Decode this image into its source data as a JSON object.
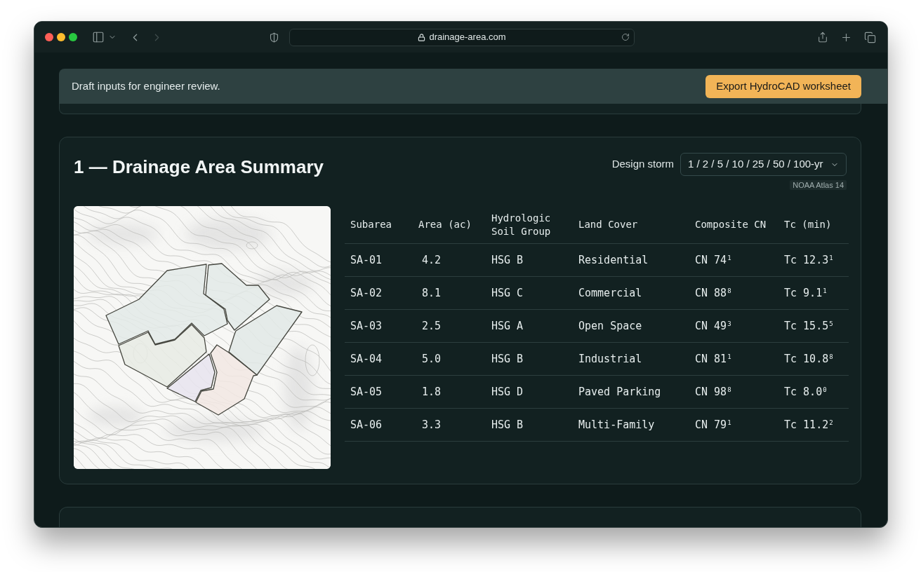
{
  "browser": {
    "nav": [
      {
        "kind": "back",
        "disabled": false
      },
      {
        "kind": "forward",
        "disabled": true
      }
    ],
    "url": "drainage-area.com"
  },
  "banner": {
    "message": "Draft inputs for engineer review.",
    "action": "Export HydroCAD worksheet"
  },
  "section": {
    "title": "1 — Drainage Area Summary",
    "storm_label": "Design storm",
    "storm_value": "1 / 2 / 5 / 10 / 25 / 50 / 100-yr",
    "source_badge": "NOAA Atlas 14"
  },
  "table": {
    "columns": [
      "Subarea",
      "Area (ac)",
      "Hydrologic Soil Group",
      "Land Cover",
      "Composite CN",
      "Tc (min)"
    ],
    "rows": [
      [
        "SA-01",
        "4.2",
        "HSG B",
        "Residential",
        "CN 74$^{1}$",
        "Tc 12.3$^{1}$"
      ],
      [
        "SA-02",
        "8.1",
        "HSG C",
        "Commercial",
        "CN 88$^{8}$",
        "Tc 9.1$^{1}$"
      ],
      [
        "SA-03",
        "2.5",
        "HSG A",
        "Open Space",
        "CN 49$^{3}$",
        "Tc 15.5$^{5}$"
      ],
      [
        "SA-04",
        "5.0",
        "HSG B",
        "Industrial",
        "CN 81$^{1}$",
        "Tc 10.8$^{8}$"
      ],
      [
        "SA-05",
        "1.8",
        "HSG D",
        "Paved Parking",
        "CN 98$^{8}$",
        "Tc 8.0$^{0}$"
      ],
      [
        "SA-06",
        "3.3",
        "HSG B",
        "Multi-Family",
        "CN 79$^{1}$",
        "Tc 11.2$^{2}$"
      ]
    ]
  }
}
